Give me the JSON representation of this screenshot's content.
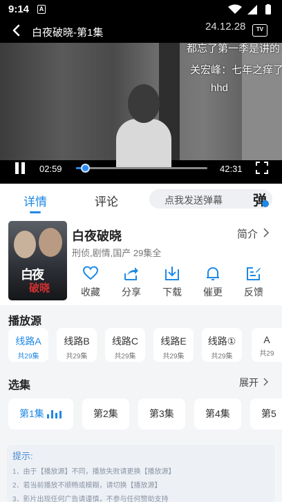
{
  "status_bar": {
    "time": "9:14",
    "notif_icon": "A"
  },
  "player": {
    "title": "白夜破晓-第1集",
    "date_watermark": "24.12.28",
    "tv_label": "TV",
    "danmaku": [
      "都忘了第一季是讲的",
      "关宏峰：七年之痒了",
      "hhd"
    ],
    "current_time": "02:59",
    "total_time": "42:31",
    "progress": 0.07
  },
  "tabs": {
    "details": "详情",
    "comments": "评论",
    "danmaku_placeholder": "点我发送弹幕",
    "danmaku_icon": "弹"
  },
  "show": {
    "poster_title": "白夜",
    "poster_sub": "破晓",
    "title": "白夜破晓",
    "meta": "刑侦,剧情,国产 29集全",
    "intro_label": "简介",
    "actions": [
      {
        "label": "收藏",
        "icon": "heart-icon"
      },
      {
        "label": "分享",
        "icon": "share-icon"
      },
      {
        "label": "下载",
        "icon": "download-icon"
      },
      {
        "label": "催更",
        "icon": "bell-icon"
      },
      {
        "label": "反馈",
        "icon": "feedback-icon"
      }
    ]
  },
  "sources": {
    "title": "播放源",
    "items": [
      {
        "name": "线路A",
        "count": "共29集"
      },
      {
        "name": "线路B",
        "count": "共29集"
      },
      {
        "name": "线路C",
        "count": "共29集"
      },
      {
        "name": "线路E",
        "count": "共29集"
      },
      {
        "name": "线路①",
        "count": "共29集"
      },
      {
        "name": "A",
        "count": "共29"
      }
    ]
  },
  "episodes": {
    "title": "选集",
    "expand_label": "展开",
    "items": [
      "第1集",
      "第2集",
      "第3集",
      "第4集",
      "第5"
    ]
  },
  "tips": {
    "title": "提示:",
    "lines": [
      "1．由于【播放源】不同，播放失败请更换【播放源】",
      "2．若当前播放不顺畅或模糊，请切换【播放源】",
      "3．影片出现任何广告请谨慎，不参与任何赞助支持"
    ]
  },
  "colors": {
    "accent": "#1e88e5"
  }
}
